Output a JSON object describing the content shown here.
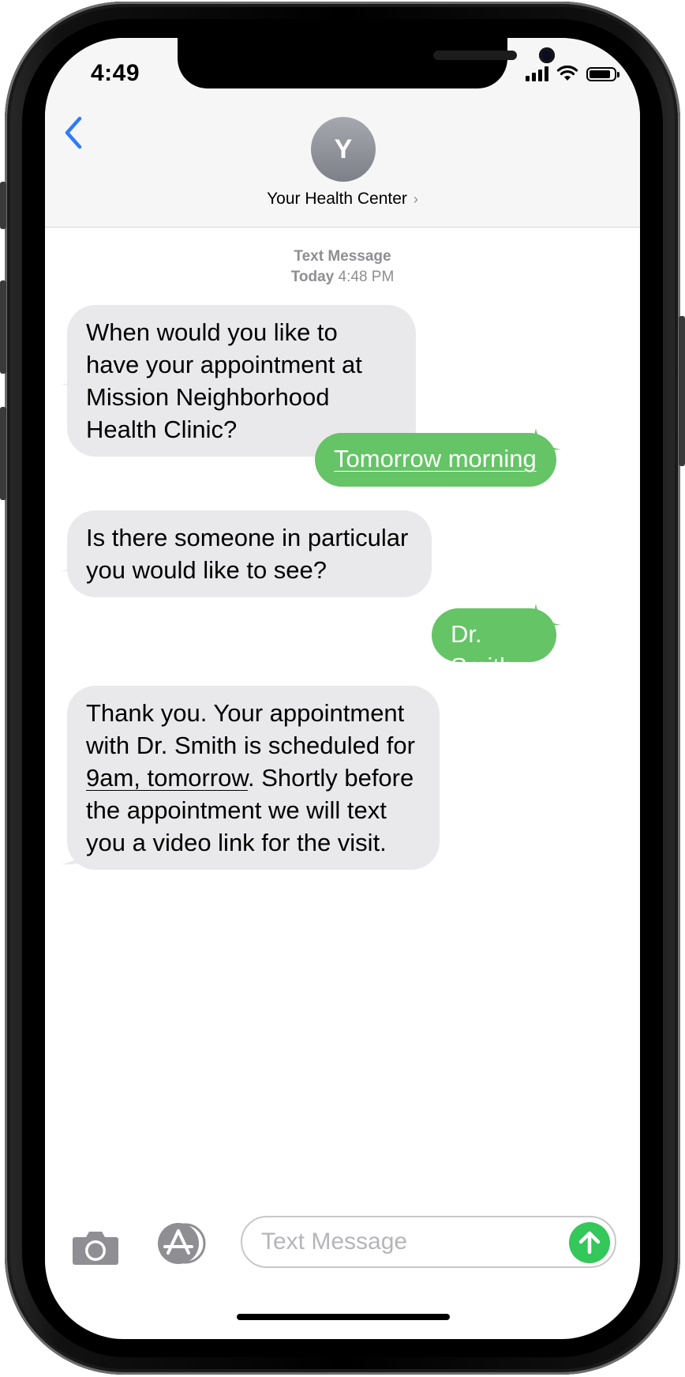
{
  "status_bar": {
    "time": "4:49"
  },
  "header": {
    "avatar_initial": "Y",
    "contact_name": "Your Health Center",
    "chevron": "›",
    "back_icon": "chevron-left-icon"
  },
  "conversation": {
    "meta_service": "Text Message",
    "meta_day": "Today",
    "meta_time": "4:48 PM",
    "messages": [
      {
        "direction": "incoming",
        "text": "When would you like to have your appointment at Mission Neighborhood Health Clinic?"
      },
      {
        "direction": "outgoing",
        "text": "Tomorrow morning"
      },
      {
        "direction": "incoming",
        "text": "Is there someone in particular you would like to see?"
      },
      {
        "direction": "outgoing",
        "text": "Dr. Smith"
      },
      {
        "direction": "incoming",
        "text_before": "Thank you. Your appointment with Dr. Smith is scheduled for",
        "text_link": "9am, tomorrow",
        "text_after": ". Shortly before the appointment we will text you a video link for the visit."
      }
    ]
  },
  "composer": {
    "placeholder": "Text Message",
    "camera_icon": "camera-icon",
    "apps_icon": "app-store-icon",
    "send_icon": "send-arrow-icon"
  },
  "colors": {
    "incoming_bubble": "#e9e9eb",
    "outgoing_bubble": "#65c466",
    "accent_blue": "#2e7cf6",
    "send_green": "#34c759"
  }
}
